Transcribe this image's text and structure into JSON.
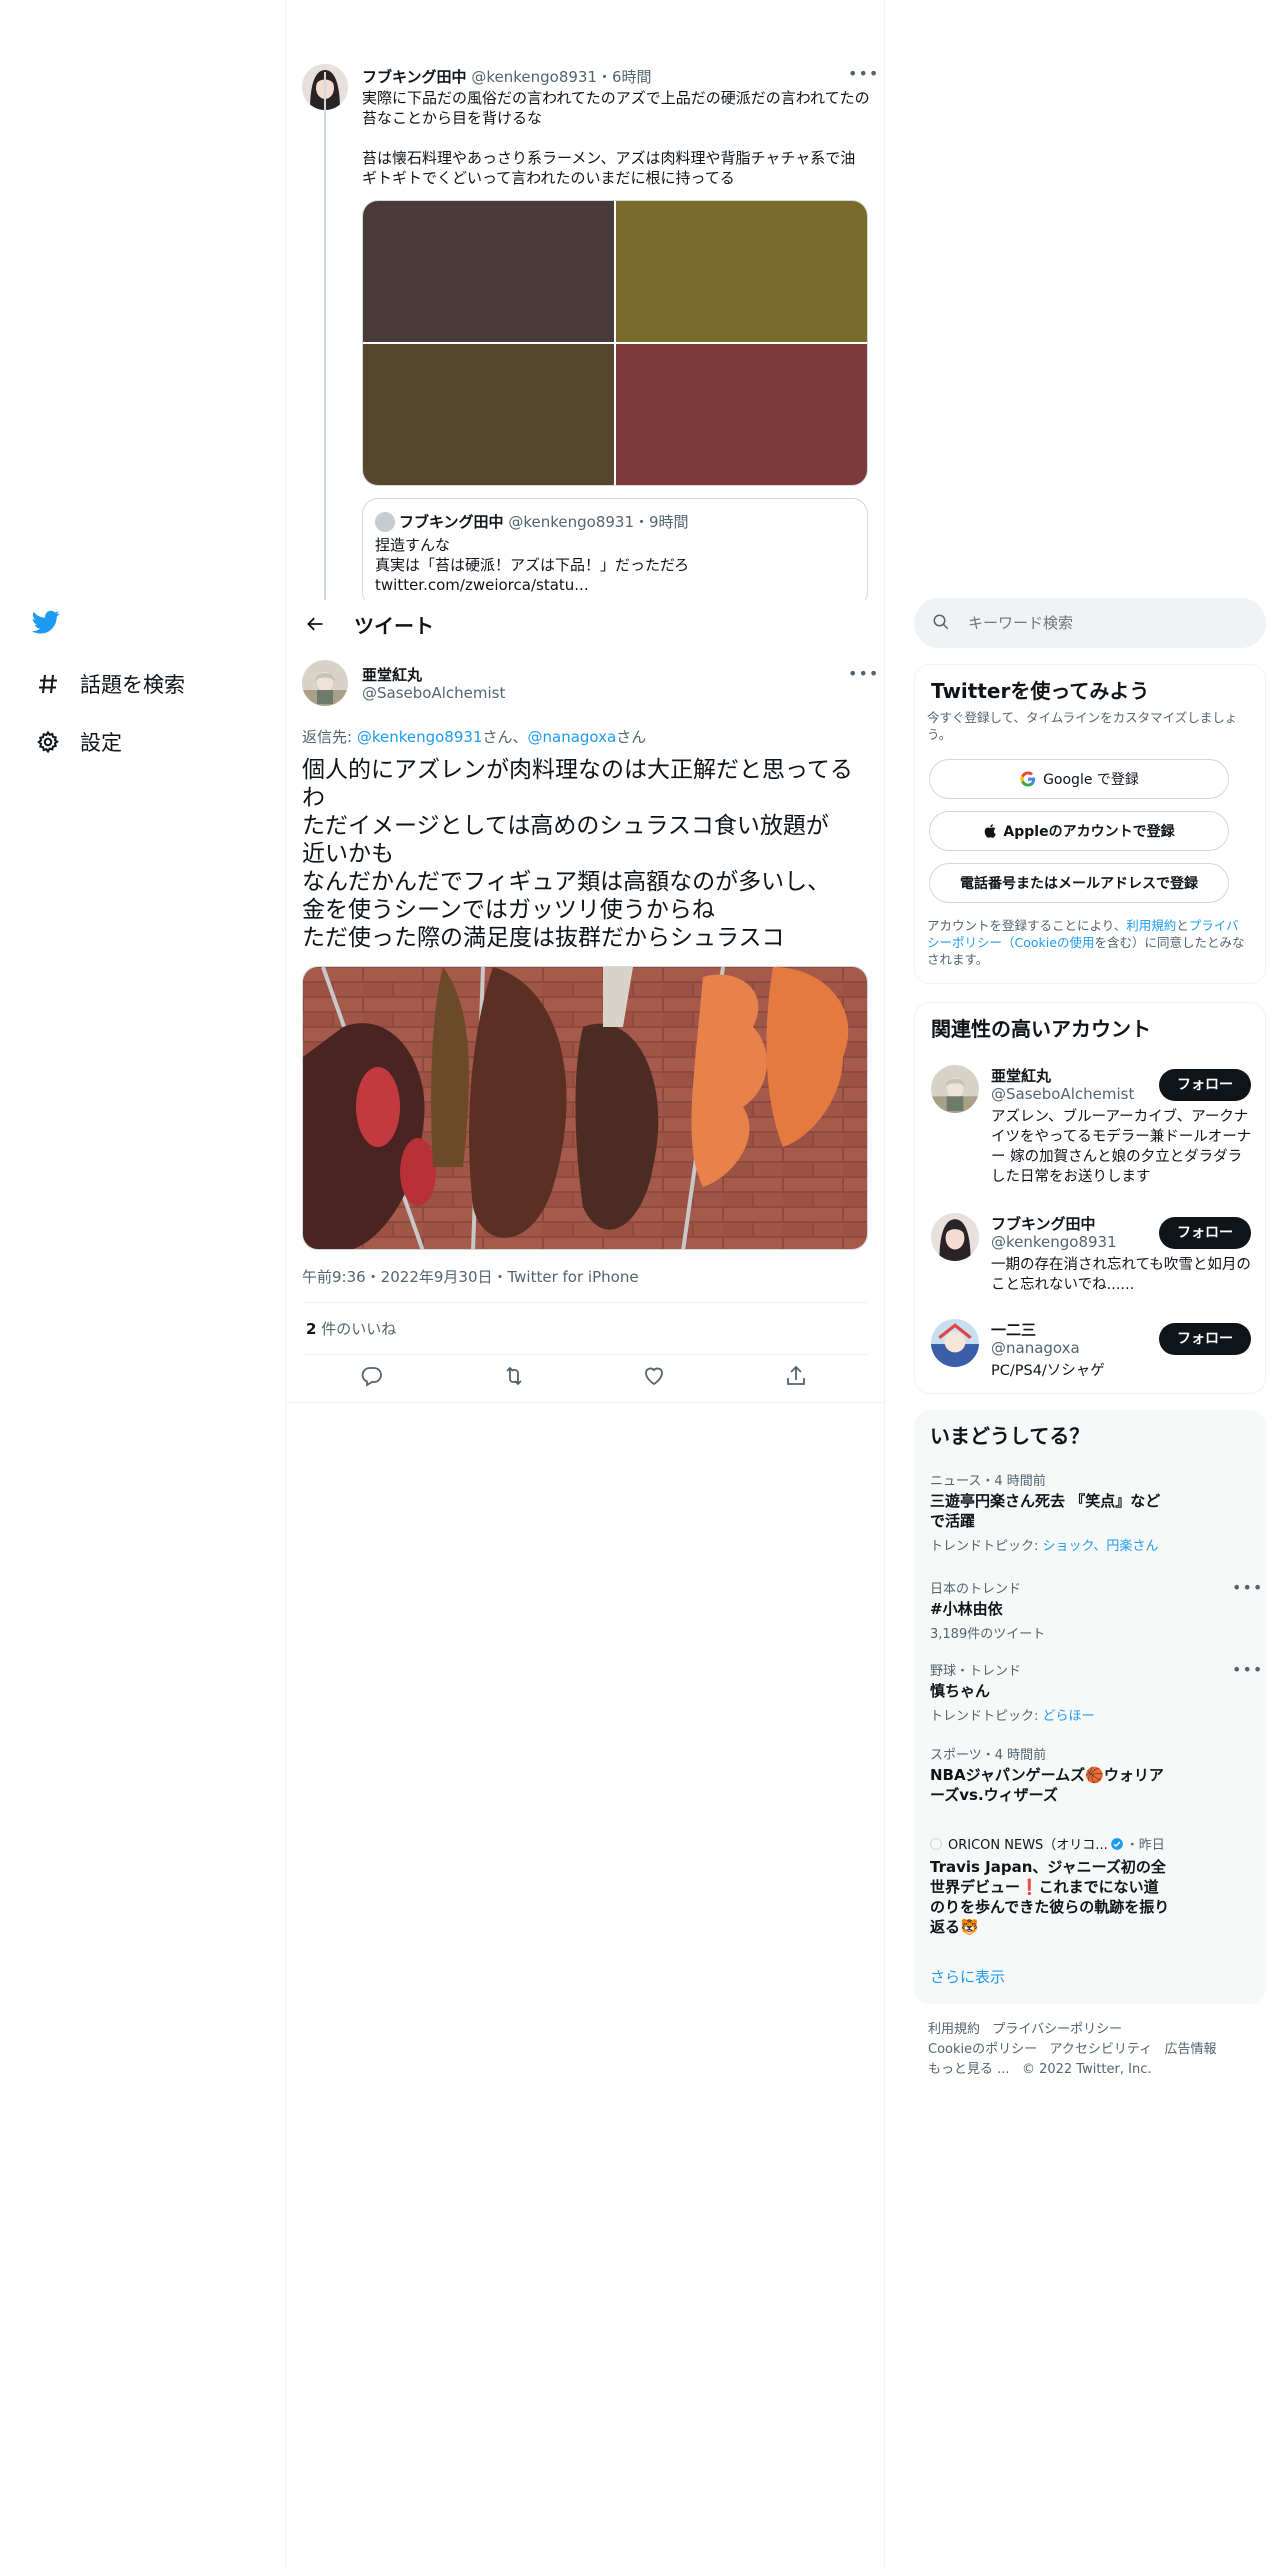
{
  "nav": {
    "explore_label": "話題を検索",
    "settings_label": "設定"
  },
  "parent_tweet": {
    "author_name": "フブキング田中",
    "author_handle": "@kenkengo8931",
    "time": "・6時間",
    "text1": "実際に下品だの風俗だの言われてたのアズで上品だの硬派だの言われてたの苔なことから目を背けるな",
    "text2": "苔は懐石料理やあっさり系ラーメン、アズは肉料理や背脂チャチャ系で油ギトギトでくどいって言われたのいまだに根に持ってる",
    "image_colors": [
      "#4a3b3a",
      "#7a6b2c",
      "#55472e",
      "#7c3a3a"
    ],
    "quoted": {
      "author_name": "フブキング田中",
      "author_handle": "@kenkengo8931",
      "time": "・9時間",
      "line1": "捏造すんな",
      "line2": "真実は「苔は硬派！アズは下品！」だっただろ",
      "line3": "twitter.com/zweiorca/statu..."
    }
  },
  "header": {
    "title": "ツイート"
  },
  "main_tweet": {
    "author_name": "亜堂紅丸",
    "author_handle": "@SaseboAlchemist",
    "reply_prefix": "返信先: ",
    "reply_to_1": "@kenkengo8931",
    "reply_san_1": "さん、",
    "reply_to_2": "@nanagoxa",
    "reply_san_2": "さん",
    "lines": [
      "個人的にアズレンが肉料理なのは大正解だと思ってる",
      "わ",
      "ただイメージとしては高めのシュラスコ食い放題が",
      "近いかも",
      "なんだかんだでフィギュア類は高額なのが多いし、",
      "金を使うシーンではガッツリ使うからね",
      "ただ使った際の満足度は抜群だからシュラスコ"
    ],
    "timestamp": "午前9:36・2022年9月30日・Twitter for iPhone",
    "likes_count": "2",
    "likes_label": " 件のいいね"
  },
  "search": {
    "placeholder": "キーワード検索"
  },
  "signup": {
    "title": "Twitterを使ってみよう",
    "subtitle": "今すぐ登録して、タイムラインをカスタマイズしましょう。",
    "google": "Google で登録",
    "apple": "Appleのアカウントで登録",
    "phone": "電話番号またはメールアドレスで登録",
    "legal_1": "アカウントを登録することにより、",
    "legal_terms": "利用規約",
    "legal_2": "と",
    "legal_privacy": "プライバシーポリシー",
    "legal_cookie": "（Cookieの使用",
    "legal_3": "を含む）に同意したとみなされます。"
  },
  "related": {
    "title": "関連性の高いアカウント",
    "follow_label": "フォロー",
    "accounts": [
      {
        "name": "亜堂紅丸",
        "handle": "@SaseboAlchemist",
        "bio": "アズレン、ブルーアーカイブ、アークナイツをやってるモデラー兼ドールオーナー 嫁の加賀さんと娘の夕立とダラダラした日常をお送りします"
      },
      {
        "name": "フブキング田中",
        "handle": "@kenkengo8931",
        "bio": "一期の存在消され忘れても吹雪と如月のこと忘れないでね......"
      },
      {
        "name": "一二三",
        "handle": "@nanagoxa",
        "bio": "PC/PS4/ソシャゲ"
      }
    ]
  },
  "trends": {
    "title": "いまどうしてる？",
    "items": [
      {
        "meta": "ニュース・4 時間前",
        "name": "三遊亭円楽さん死去 『笑点』などで活躍",
        "topics_label": "トレンドトピック: ",
        "topics": "ショック、円楽さん"
      },
      {
        "meta": "日本のトレンド",
        "name": "#小林由依",
        "count": "3,189件のツイート"
      },
      {
        "meta": "野球・トレンド",
        "name": "慎ちゃん",
        "topics_label": "トレンドトピック: ",
        "topics": "どらほー"
      },
      {
        "meta": "スポーツ・4 時間前",
        "name": "NBAジャパンゲームズ🏀ウォリアーズvs.ウィザーズ"
      },
      {
        "meta_source": "ORICON NEWS（オリコ...",
        "meta_time": "・昨日",
        "name": "Travis Japan、ジャニーズ初の全世界デビュー❗これまでにない道のりを歩んできた彼らの軌跡を振り返る🐯"
      }
    ],
    "show_more": "さらに表示"
  },
  "footer": {
    "links": [
      "利用規約",
      "プライバシーポリシー",
      "Cookieのポリシー",
      "アクセシビリティ",
      "広告情報",
      "もっと見る ..."
    ],
    "copyright": "© 2022 Twitter, Inc."
  },
  "colors": {
    "accent": "#1d9bf0",
    "text": "#0f1419",
    "muted": "#536471",
    "divider": "#eff3f4"
  }
}
